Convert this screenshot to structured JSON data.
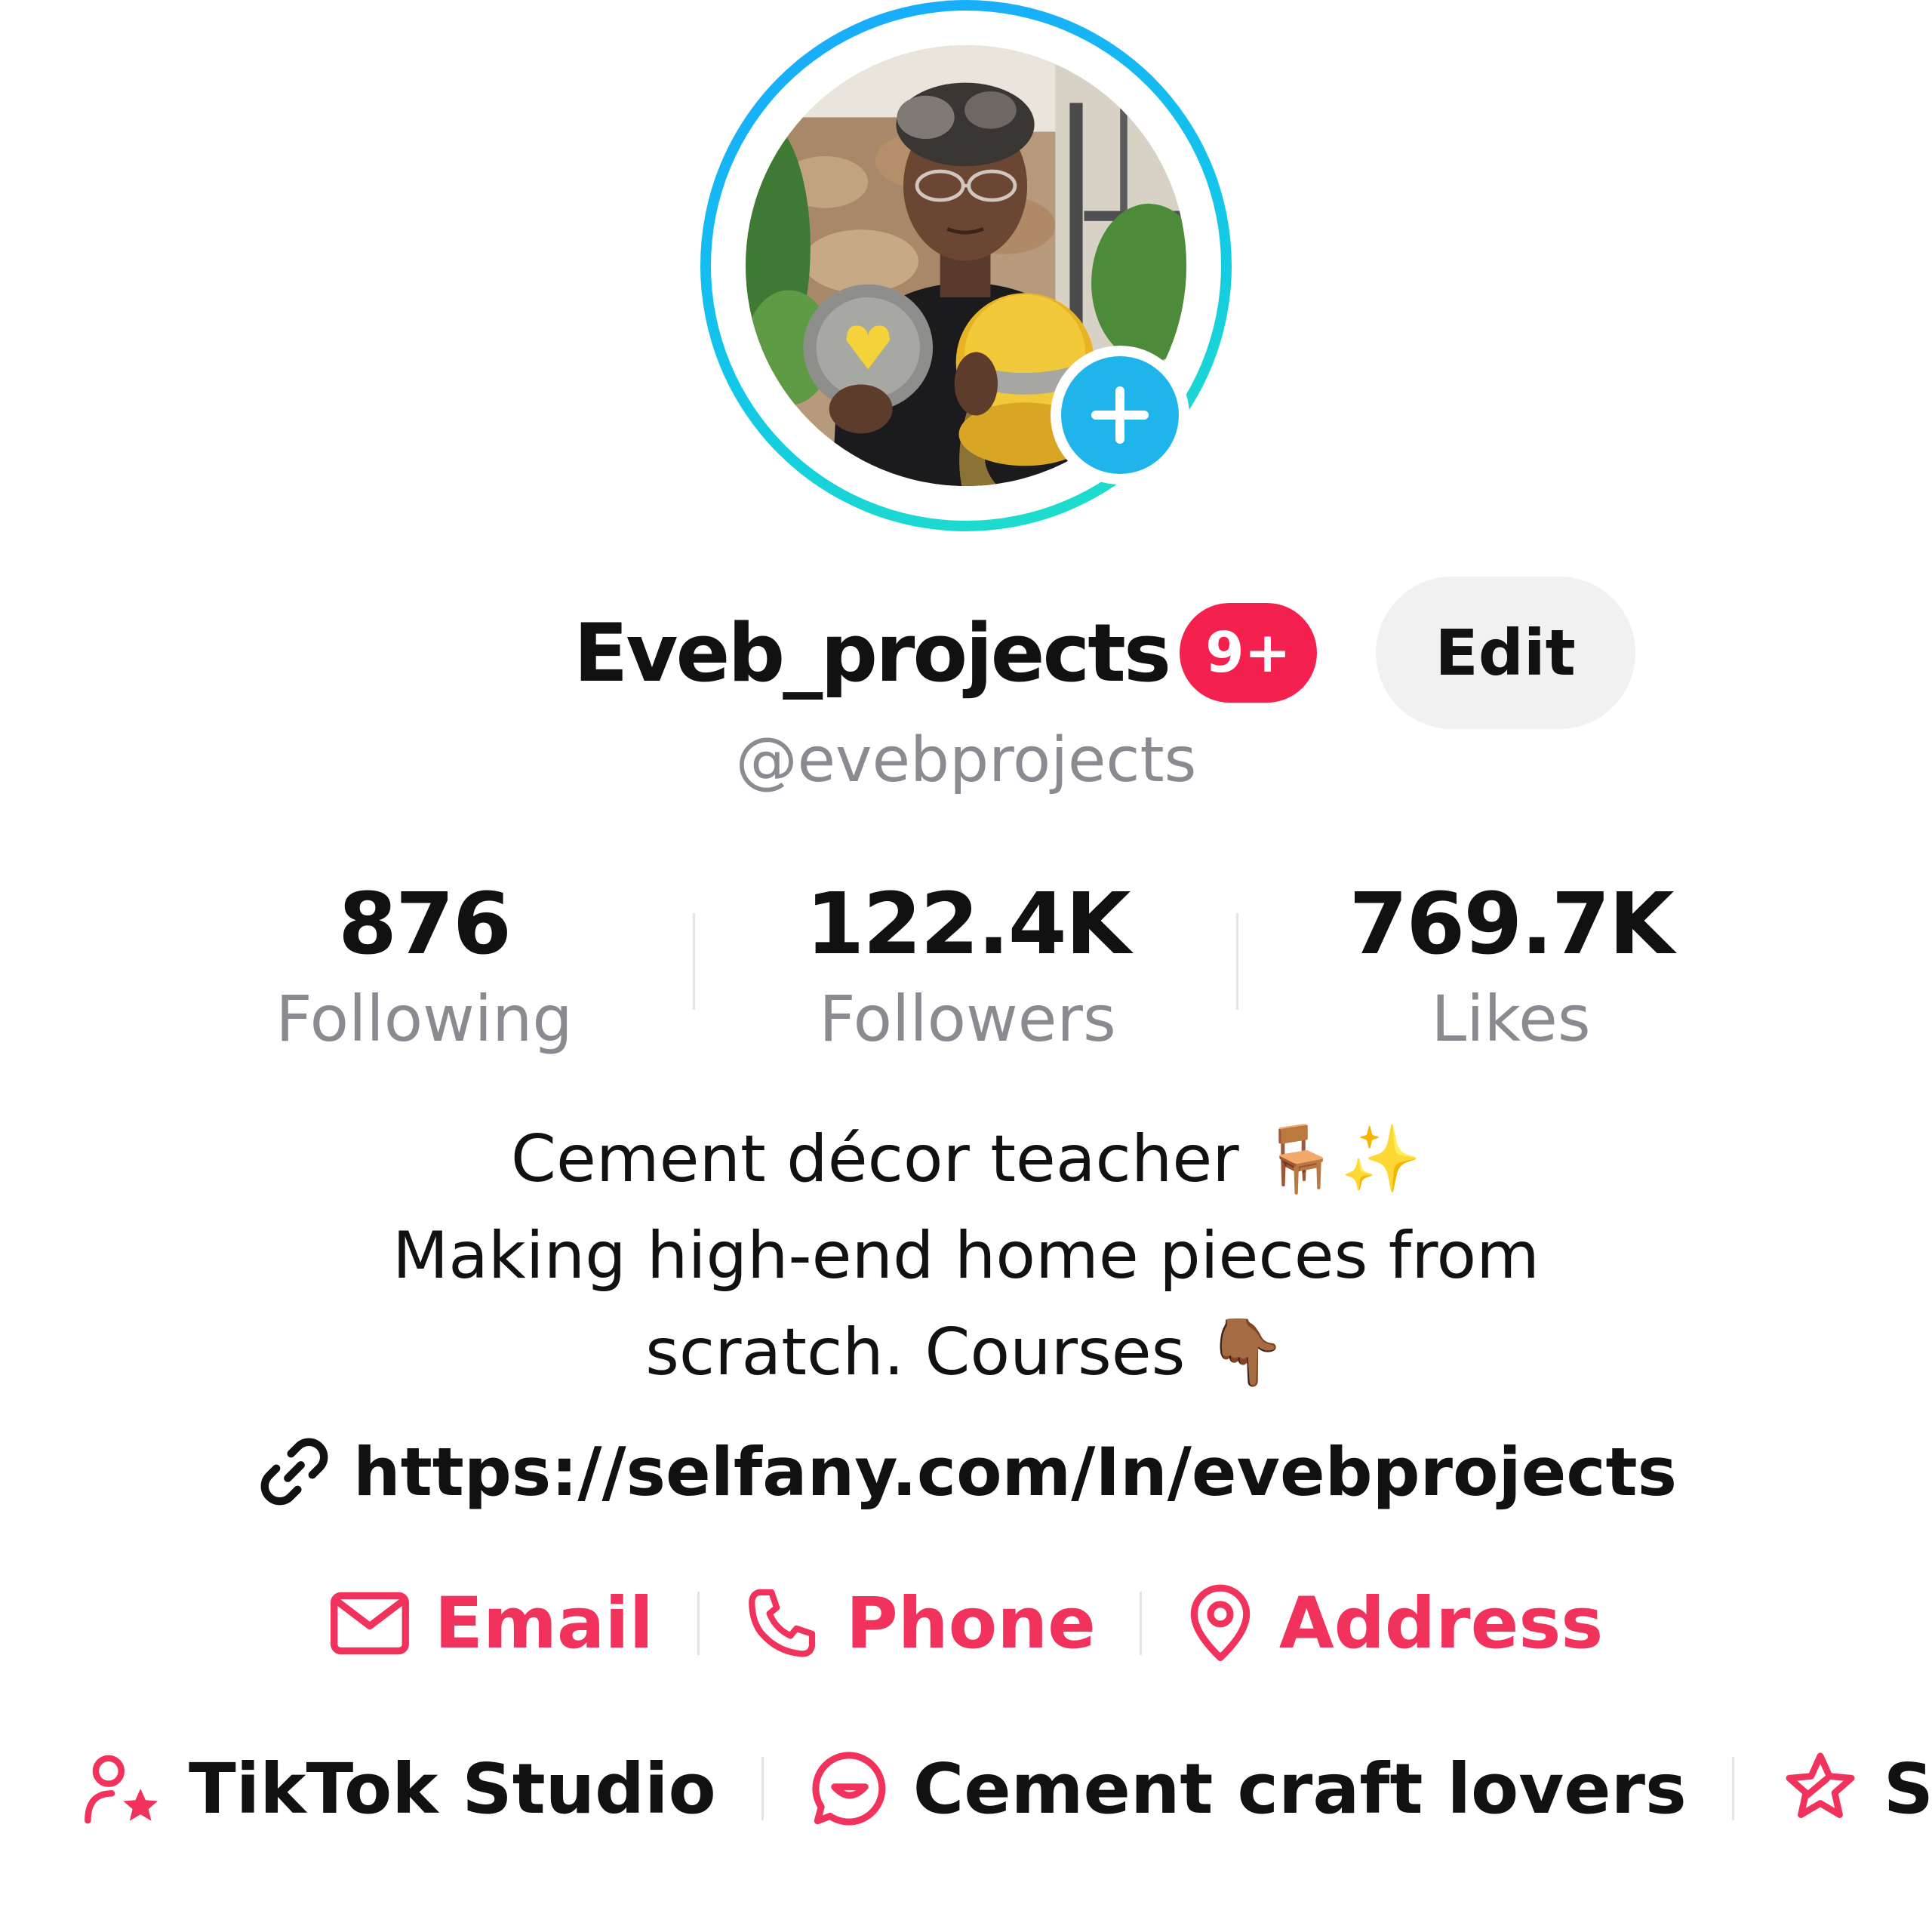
{
  "profile": {
    "display_name": "Eveb_projects",
    "notification_badge": "9+",
    "edit_label": "Edit",
    "handle": "@evebprojects"
  },
  "stats": [
    {
      "value": "876",
      "label": "Following"
    },
    {
      "value": "122.4K",
      "label": "Followers"
    },
    {
      "value": "769.7K",
      "label": "Likes"
    }
  ],
  "bio": {
    "line1": "Cement décor teacher 🪑✨",
    "line2": "Making high-end home pieces from",
    "line3": "scratch. Courses 👇🏾"
  },
  "link": {
    "icon": "link-icon",
    "url": "https://selfany.com/In/evebprojects"
  },
  "contacts": [
    {
      "icon": "envelope-icon",
      "label": "Email"
    },
    {
      "icon": "phone-icon",
      "label": "Phone"
    },
    {
      "icon": "location-pin-icon",
      "label": "Address"
    }
  ],
  "tools": [
    {
      "icon": "creator-star-icon",
      "label": "TikTok Studio"
    },
    {
      "icon": "chat-bubble-icon",
      "label": "Cement craft lovers"
    },
    {
      "icon": "star-badge-icon",
      "label": "Su"
    }
  ],
  "colors": {
    "accent": "#f0325c",
    "badge": "#f4214f",
    "avatar_add": "#1fb5ea",
    "ring_start": "#1aa6ff",
    "ring_end": "#20e3c4",
    "muted_text": "#8a8b91"
  }
}
